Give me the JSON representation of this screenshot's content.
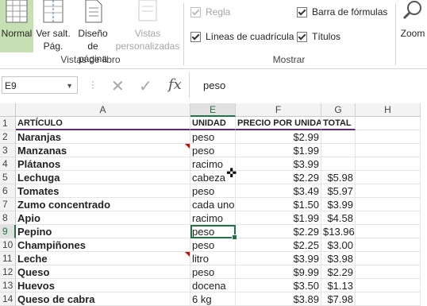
{
  "ribbon": {
    "views": {
      "normal": "Normal",
      "page_break": "Ver salt.\nPág.",
      "page_layout": "Diseño\nde página",
      "custom_views": "Vistas\npersonalizadas",
      "group_label": "Vistas de libro"
    },
    "show": {
      "ruler": "Regla",
      "gridlines": "Líneas de cuadrícula",
      "formula_bar": "Barra de fórmulas",
      "headings": "Títulos",
      "group_label": "Mostrar"
    },
    "zoom": "Zoom"
  },
  "formula_bar": {
    "name_box": "E9",
    "fx": "fx",
    "value": "peso"
  },
  "columns": [
    "A",
    "E",
    "F",
    "G",
    "H"
  ],
  "rows": [
    "1",
    "2",
    "3",
    "4",
    "5",
    "6",
    "7",
    "8",
    "9",
    "10",
    "11",
    "12",
    "13",
    "14"
  ],
  "table": {
    "headers": [
      "ARTÍCULO",
      "UNIDAD",
      "PRECIO POR UNIDAD",
      "TOTAL"
    ],
    "data": [
      [
        "Naranjas",
        "peso",
        "$2.99",
        ""
      ],
      [
        "Manzanas",
        "peso",
        "$1.99",
        ""
      ],
      [
        "Plátanos",
        "racimo",
        "$3.99",
        ""
      ],
      [
        "Lechuga",
        "cabeza",
        "$2.29",
        "$5.98"
      ],
      [
        "Tomates",
        "peso",
        "$3.49",
        "$5.97"
      ],
      [
        "Zumo concentrado",
        "cada uno",
        "$1.50",
        "$3.99"
      ],
      [
        "Apio",
        "racimo",
        "$1.99",
        "$4.58"
      ],
      [
        "Pepino",
        "peso",
        "$2.29",
        "$13.96"
      ],
      [
        "Champiñones",
        "peso",
        "$2.25",
        "$3.00"
      ],
      [
        "Leche",
        "litro",
        "$3.99",
        "$3.98"
      ],
      [
        "Queso",
        "peso",
        "$9.99",
        "$2.29"
      ],
      [
        "Huevos",
        "docena",
        "$3.50",
        "$1.13"
      ],
      [
        "Queso de cabra",
        "6 kg",
        "$3.89",
        "$7.98"
      ]
    ]
  },
  "colors": {
    "accent": "#217346",
    "header_line": "#5b2c6f",
    "comment": "#e00000"
  }
}
